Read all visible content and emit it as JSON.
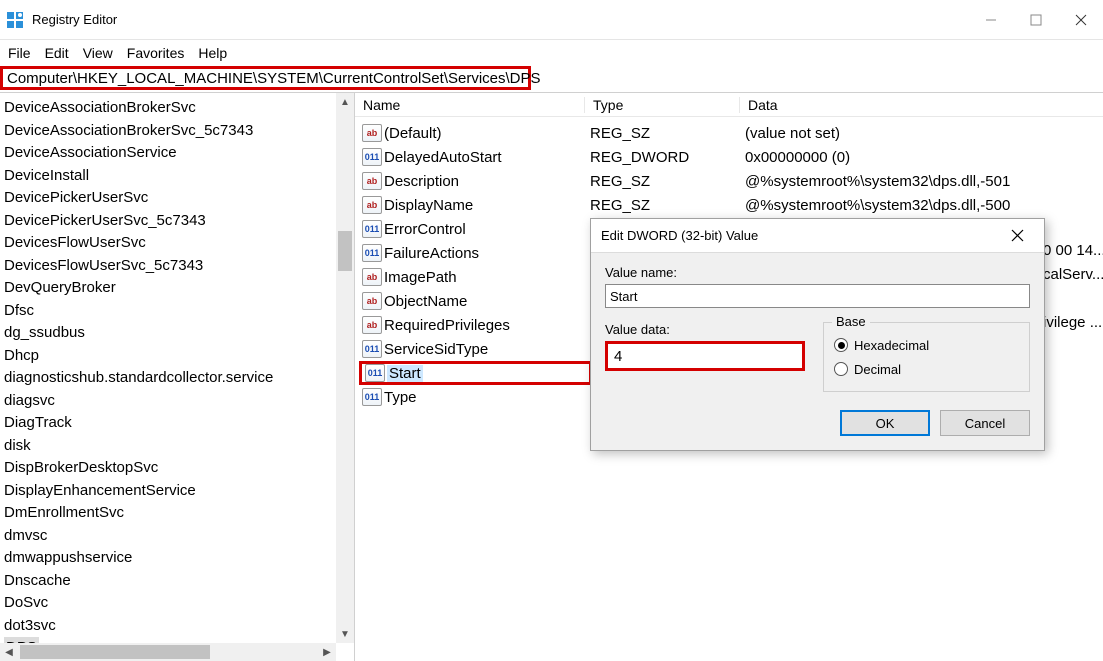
{
  "window": {
    "title": "Registry Editor"
  },
  "menu": {
    "file": "File",
    "edit": "Edit",
    "view": "View",
    "favorites": "Favorites",
    "help": "Help"
  },
  "address": "Computer\\HKEY_LOCAL_MACHINE\\SYSTEM\\CurrentControlSet\\Services\\DPS",
  "tree_items": [
    "DeviceAssociationBrokerSvc",
    "DeviceAssociationBrokerSvc_5c7343",
    "DeviceAssociationService",
    "DeviceInstall",
    "DevicePickerUserSvc",
    "DevicePickerUserSvc_5c7343",
    "DevicesFlowUserSvc",
    "DevicesFlowUserSvc_5c7343",
    "DevQueryBroker",
    "Dfsc",
    "dg_ssudbus",
    "Dhcp",
    "diagnosticshub.standardcollector.service",
    "diagsvc",
    "DiagTrack",
    "disk",
    "DispBrokerDesktopSvc",
    "DisplayEnhancementService",
    "DmEnrollmentSvc",
    "dmvsc",
    "dmwappushservice",
    "Dnscache",
    "DoSvc",
    "dot3svc",
    "DPS"
  ],
  "selected_tree_item": "DPS",
  "columns": {
    "name": "Name",
    "type": "Type",
    "data": "Data"
  },
  "values": [
    {
      "icon": "str",
      "name": "(Default)",
      "type": "REG_SZ",
      "data": "(value not set)"
    },
    {
      "icon": "bin",
      "name": "DelayedAutoStart",
      "type": "REG_DWORD",
      "data": "0x00000000 (0)"
    },
    {
      "icon": "str",
      "name": "Description",
      "type": "REG_SZ",
      "data": "@%systemroot%\\system32\\dps.dll,-501"
    },
    {
      "icon": "str",
      "name": "DisplayName",
      "type": "REG_SZ",
      "data": "@%systemroot%\\system32\\dps.dll,-500"
    },
    {
      "icon": "bin",
      "name": "ErrorControl",
      "type": "",
      "data": ""
    },
    {
      "icon": "bin",
      "name": "FailureActions",
      "type": "",
      "data": ""
    },
    {
      "icon": "str",
      "name": "ImagePath",
      "type": "",
      "data": ""
    },
    {
      "icon": "str",
      "name": "ObjectName",
      "type": "",
      "data": ""
    },
    {
      "icon": "str",
      "name": "RequiredPrivileges",
      "type": "",
      "data": ""
    },
    {
      "icon": "bin",
      "name": "ServiceSidType",
      "type": "",
      "data": ""
    },
    {
      "icon": "bin",
      "name": "Start",
      "type": "",
      "data": "",
      "selected": true
    },
    {
      "icon": "bin",
      "name": "Type",
      "type": "",
      "data": ""
    }
  ],
  "overflow": {
    "r1": "0 00 14...",
    "r2": "calServ...",
    "r3": "ivilege ..."
  },
  "dialog": {
    "title": "Edit DWORD (32-bit) Value",
    "value_name_label": "Value name:",
    "value_name": "Start",
    "value_data_label": "Value data:",
    "value_data": "4",
    "base_label": "Base",
    "hex_label": "Hexadecimal",
    "dec_label": "Decimal",
    "ok": "OK",
    "cancel": "Cancel"
  },
  "icon_text": {
    "str": "ab",
    "bin": "011\n110"
  }
}
